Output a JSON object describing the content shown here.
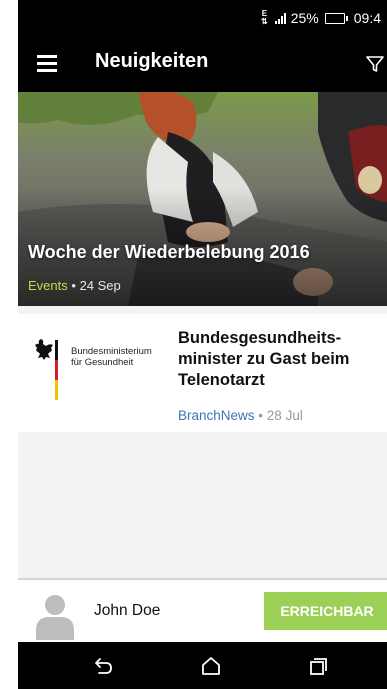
{
  "status_bar": {
    "data_label": "E",
    "battery_percent": "25%",
    "time": "09:4"
  },
  "toolbar": {
    "title": "Neuigkeiten",
    "menu_icon": "hamburger-menu-icon",
    "filter_icon": "filter-funnel-icon"
  },
  "featured_news": {
    "title": "Woche der Wiederbelebung 2016",
    "category": "Events",
    "separator": "•",
    "date": "24 Sep",
    "category_color": "#c3dc56"
  },
  "news_items": [
    {
      "logo_lines": [
        "Bundesministerium",
        "für Gesundheit"
      ],
      "title": "Bundesgesundheits-minister zu Gast beim Telenotarzt",
      "source": "BranchNews",
      "separator": "•",
      "date": "28 Jul",
      "source_color": "#3f74b6"
    }
  ],
  "user": {
    "name": "John Doe",
    "status_label": "ERREICHBAR",
    "status_color": "#9ccf55"
  },
  "nav": {
    "back_icon": "back-arrow-icon",
    "home_icon": "home-icon",
    "recents_icon": "recent-apps-icon"
  }
}
